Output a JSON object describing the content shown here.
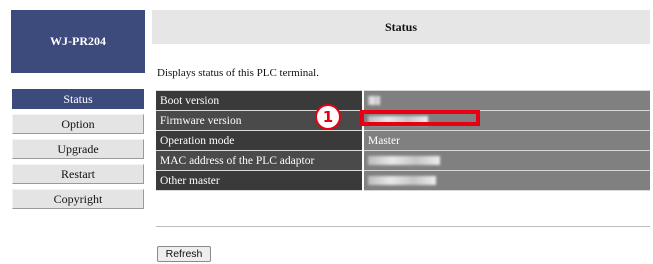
{
  "logo": {
    "text": "WJ-PR204"
  },
  "nav": {
    "items": [
      {
        "label": "Status",
        "active": true
      },
      {
        "label": "Option",
        "active": false
      },
      {
        "label": "Upgrade",
        "active": false
      },
      {
        "label": "Restart",
        "active": false
      },
      {
        "label": "Copyright",
        "active": false
      }
    ]
  },
  "header": {
    "title": "Status"
  },
  "main": {
    "description": "Displays status of this PLC terminal.",
    "rows": [
      {
        "label": "Boot version",
        "value": ""
      },
      {
        "label": "Firmware version",
        "value": ""
      },
      {
        "label": "Operation mode",
        "value": "Master"
      },
      {
        "label": "MAC address of the PLC adaptor",
        "value": ""
      },
      {
        "label": "Other master",
        "value": ""
      }
    ],
    "refresh_label": "Refresh"
  },
  "annotation": {
    "marker": "1",
    "color": "#e60012"
  },
  "colors": {
    "nav_active": "#3d4a7c",
    "logo_bg": "#3d4a7c"
  }
}
